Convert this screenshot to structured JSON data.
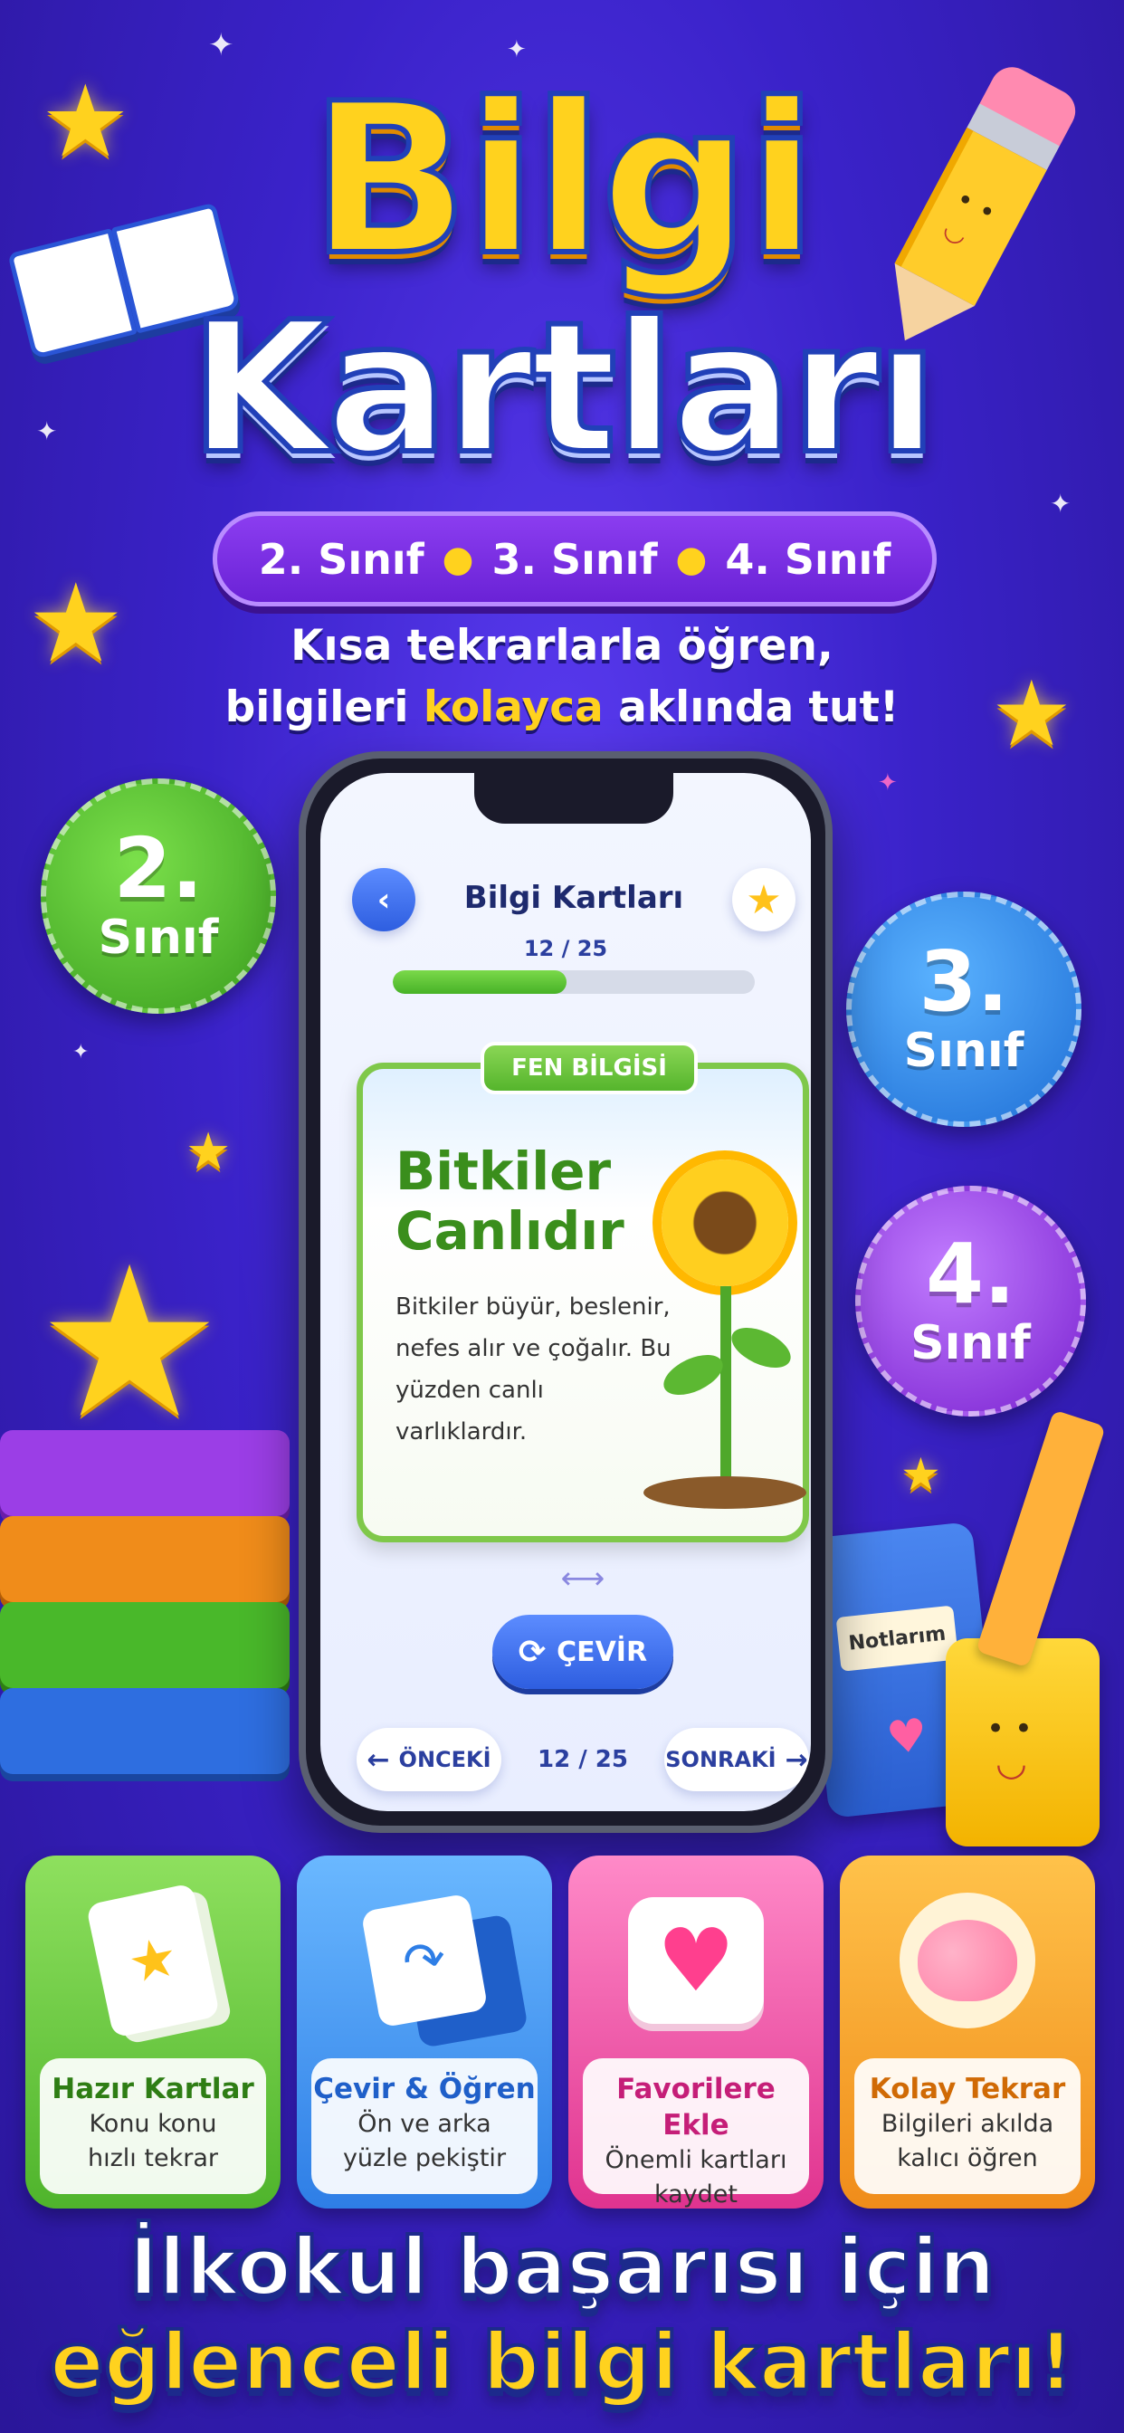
{
  "header": {
    "title_line1": "Bilgi",
    "title_line2": "Kartları",
    "grades": [
      "2. Sınıf",
      "3. Sınıf",
      "4. Sınıf"
    ],
    "tagline_line1": "Kısa tekrarlarla öğren,",
    "tagline_line2_pre": "bilgileri",
    "tagline_line2_highlight": "kolayca",
    "tagline_line2_post": "aklında tut!"
  },
  "grade_badges": [
    {
      "number": "2.",
      "label": "Sınıf",
      "color": "#49b82a"
    },
    {
      "number": "3.",
      "label": "Sınıf",
      "color": "#2e8ef0"
    },
    {
      "number": "4.",
      "label": "Sınıf",
      "color": "#9b3ee6"
    }
  ],
  "phone": {
    "app_title": "Bilgi Kartları",
    "progress_text": "12 / 25",
    "progress_fraction": 0.48,
    "card": {
      "subject": "FEN BİLGİSİ",
      "title_line1": "Bitkiler",
      "title_line2": "Canlıdır",
      "body": "Bitkiler büyür, beslenir, nefes alır ve çoğalır. Bu yüzden canlı varlıklardır."
    },
    "flip_button": "ÇEVİR",
    "prev_button": "ÖNCEKİ",
    "next_button": "SONRAKİ",
    "page_indicator": "12 / 25"
  },
  "decor": {
    "notebook_label": "Notlarım"
  },
  "features": [
    {
      "title": "Hazır Kartlar",
      "desc_line1": "Konu konu",
      "desc_line2": "hızlı tekrar",
      "color": "#49b82a",
      "icon": "cards-icon"
    },
    {
      "title": "Çevir & Öğren",
      "desc_line1": "Ön ve arka",
      "desc_line2": "yüzle pekiştir",
      "color": "#2e8ef0",
      "icon": "flip-cards-icon"
    },
    {
      "title": "Favorilere Ekle",
      "desc_line1": "Önemli kartları",
      "desc_line2": "kaydet",
      "color": "#e0338f",
      "icon": "heart-icon"
    },
    {
      "title": "Kolay Tekrar",
      "desc_line1": "Bilgileri akılda",
      "desc_line2": "kalıcı öğren",
      "color": "#f08c1a",
      "icon": "brain-icon"
    }
  ],
  "footer": {
    "line1": "İlkokul başarısı için",
    "line2": "eğlenceli bilgi kartları!"
  }
}
